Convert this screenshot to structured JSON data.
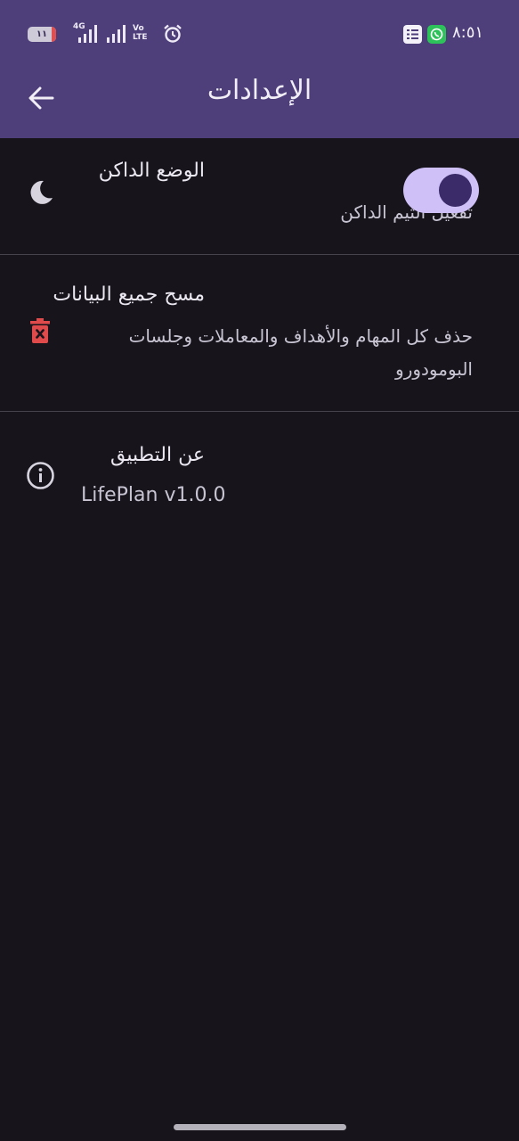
{
  "status_bar": {
    "battery": "١١",
    "battery_level_percent": 11,
    "network": "4G",
    "volte_top": "Vo",
    "volte_bottom": "LTE",
    "time": "٨:٥١",
    "icons": [
      "signal-icon",
      "signal-icon",
      "alarm-icon",
      "notification-list-icon",
      "whatsapp-icon"
    ]
  },
  "app_bar": {
    "title": "الإعدادات",
    "back_icon": "arrow-back-icon"
  },
  "settings": [
    {
      "id": "dark-mode",
      "icon": "moon-icon",
      "title": "الوضع الداكن",
      "subtitle": "تفعيل الثيم الداكن",
      "toggle_on": true
    },
    {
      "id": "clear-data",
      "icon": "delete-bin-icon",
      "title": "مسح جميع البيانات",
      "subtitle": "حذف كل المهام والأهداف والمعاملات وجلسات البومودورو"
    },
    {
      "id": "about",
      "icon": "info-icon",
      "title": "عن التطبيق",
      "subtitle": "LifePlan v1.0.0"
    }
  ],
  "colors": {
    "app_bar": "#4e3f7b",
    "background": "#17141c",
    "toggle_track": "#cfc0f8",
    "toggle_thumb": "#3b2c69",
    "delete_icon": "#e04a4a"
  }
}
